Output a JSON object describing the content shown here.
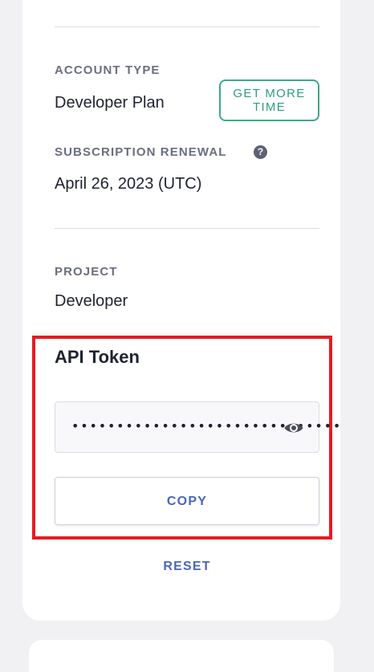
{
  "account": {
    "type_label": "ACCOUNT TYPE",
    "type_value": "Developer Plan",
    "get_more_time_label": "GET MORE TIME",
    "renewal_label": "SUBSCRIPTION RENEWAL",
    "renewal_value": "April 26, 2023 (UTC)"
  },
  "project": {
    "label": "PROJECT",
    "value": "Developer"
  },
  "api_token": {
    "title": "API Token",
    "masked_value": "••••••••••••••••••••••••••••••",
    "copy_label": "COPY",
    "reset_label": "RESET"
  },
  "icons": {
    "help": "question-circle-icon",
    "visibility": "eye-icon"
  },
  "colors": {
    "accent_green": "#3eaa82",
    "link_blue": "#4b66b8",
    "highlight_red": "#e51c24"
  }
}
